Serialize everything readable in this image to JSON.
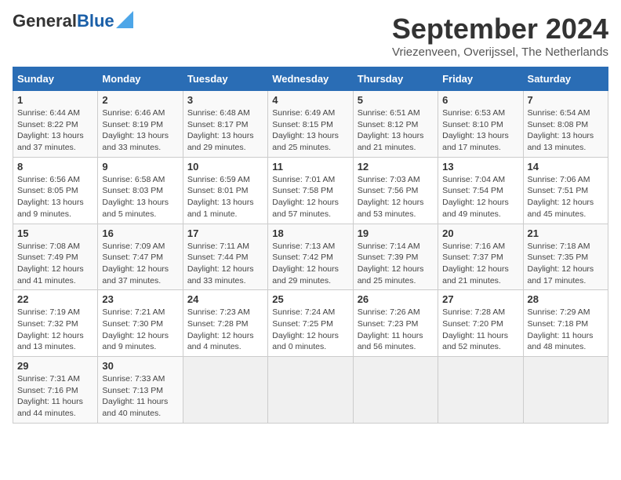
{
  "header": {
    "logo_general": "General",
    "logo_blue": "Blue",
    "month_title": "September 2024",
    "location": "Vriezenveen, Overijssel, The Netherlands"
  },
  "calendar": {
    "days_of_week": [
      "Sunday",
      "Monday",
      "Tuesday",
      "Wednesday",
      "Thursday",
      "Friday",
      "Saturday"
    ],
    "weeks": [
      [
        {
          "day": "1",
          "info": "Sunrise: 6:44 AM\nSunset: 8:22 PM\nDaylight: 13 hours\nand 37 minutes."
        },
        {
          "day": "2",
          "info": "Sunrise: 6:46 AM\nSunset: 8:19 PM\nDaylight: 13 hours\nand 33 minutes."
        },
        {
          "day": "3",
          "info": "Sunrise: 6:48 AM\nSunset: 8:17 PM\nDaylight: 13 hours\nand 29 minutes."
        },
        {
          "day": "4",
          "info": "Sunrise: 6:49 AM\nSunset: 8:15 PM\nDaylight: 13 hours\nand 25 minutes."
        },
        {
          "day": "5",
          "info": "Sunrise: 6:51 AM\nSunset: 8:12 PM\nDaylight: 13 hours\nand 21 minutes."
        },
        {
          "day": "6",
          "info": "Sunrise: 6:53 AM\nSunset: 8:10 PM\nDaylight: 13 hours\nand 17 minutes."
        },
        {
          "day": "7",
          "info": "Sunrise: 6:54 AM\nSunset: 8:08 PM\nDaylight: 13 hours\nand 13 minutes."
        }
      ],
      [
        {
          "day": "8",
          "info": "Sunrise: 6:56 AM\nSunset: 8:05 PM\nDaylight: 13 hours\nand 9 minutes."
        },
        {
          "day": "9",
          "info": "Sunrise: 6:58 AM\nSunset: 8:03 PM\nDaylight: 13 hours\nand 5 minutes."
        },
        {
          "day": "10",
          "info": "Sunrise: 6:59 AM\nSunset: 8:01 PM\nDaylight: 13 hours\nand 1 minute."
        },
        {
          "day": "11",
          "info": "Sunrise: 7:01 AM\nSunset: 7:58 PM\nDaylight: 12 hours\nand 57 minutes."
        },
        {
          "day": "12",
          "info": "Sunrise: 7:03 AM\nSunset: 7:56 PM\nDaylight: 12 hours\nand 53 minutes."
        },
        {
          "day": "13",
          "info": "Sunrise: 7:04 AM\nSunset: 7:54 PM\nDaylight: 12 hours\nand 49 minutes."
        },
        {
          "day": "14",
          "info": "Sunrise: 7:06 AM\nSunset: 7:51 PM\nDaylight: 12 hours\nand 45 minutes."
        }
      ],
      [
        {
          "day": "15",
          "info": "Sunrise: 7:08 AM\nSunset: 7:49 PM\nDaylight: 12 hours\nand 41 minutes."
        },
        {
          "day": "16",
          "info": "Sunrise: 7:09 AM\nSunset: 7:47 PM\nDaylight: 12 hours\nand 37 minutes."
        },
        {
          "day": "17",
          "info": "Sunrise: 7:11 AM\nSunset: 7:44 PM\nDaylight: 12 hours\nand 33 minutes."
        },
        {
          "day": "18",
          "info": "Sunrise: 7:13 AM\nSunset: 7:42 PM\nDaylight: 12 hours\nand 29 minutes."
        },
        {
          "day": "19",
          "info": "Sunrise: 7:14 AM\nSunset: 7:39 PM\nDaylight: 12 hours\nand 25 minutes."
        },
        {
          "day": "20",
          "info": "Sunrise: 7:16 AM\nSunset: 7:37 PM\nDaylight: 12 hours\nand 21 minutes."
        },
        {
          "day": "21",
          "info": "Sunrise: 7:18 AM\nSunset: 7:35 PM\nDaylight: 12 hours\nand 17 minutes."
        }
      ],
      [
        {
          "day": "22",
          "info": "Sunrise: 7:19 AM\nSunset: 7:32 PM\nDaylight: 12 hours\nand 13 minutes."
        },
        {
          "day": "23",
          "info": "Sunrise: 7:21 AM\nSunset: 7:30 PM\nDaylight: 12 hours\nand 9 minutes."
        },
        {
          "day": "24",
          "info": "Sunrise: 7:23 AM\nSunset: 7:28 PM\nDaylight: 12 hours\nand 4 minutes."
        },
        {
          "day": "25",
          "info": "Sunrise: 7:24 AM\nSunset: 7:25 PM\nDaylight: 12 hours\nand 0 minutes."
        },
        {
          "day": "26",
          "info": "Sunrise: 7:26 AM\nSunset: 7:23 PM\nDaylight: 11 hours\nand 56 minutes."
        },
        {
          "day": "27",
          "info": "Sunrise: 7:28 AM\nSunset: 7:20 PM\nDaylight: 11 hours\nand 52 minutes."
        },
        {
          "day": "28",
          "info": "Sunrise: 7:29 AM\nSunset: 7:18 PM\nDaylight: 11 hours\nand 48 minutes."
        }
      ],
      [
        {
          "day": "29",
          "info": "Sunrise: 7:31 AM\nSunset: 7:16 PM\nDaylight: 11 hours\nand 44 minutes."
        },
        {
          "day": "30",
          "info": "Sunrise: 7:33 AM\nSunset: 7:13 PM\nDaylight: 11 hours\nand 40 minutes."
        },
        {
          "day": "",
          "info": ""
        },
        {
          "day": "",
          "info": ""
        },
        {
          "day": "",
          "info": ""
        },
        {
          "day": "",
          "info": ""
        },
        {
          "day": "",
          "info": ""
        }
      ]
    ]
  }
}
